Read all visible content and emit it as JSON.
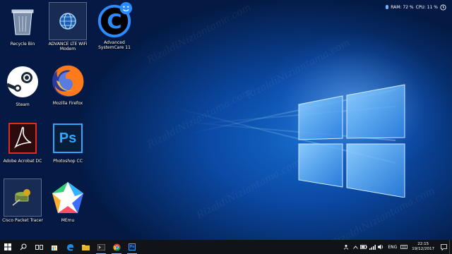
{
  "desktop": {
    "icons": [
      {
        "label": "Recycle Bin",
        "icon": "recycle-bin-icon"
      },
      {
        "label": "ADVANCE LTE WiFi Modem",
        "icon": "modem-globe-icon"
      },
      {
        "label": "Advanced SystemCare 11",
        "icon": "advanced-systemcare-icon"
      },
      {
        "label": "Steam",
        "icon": "steam-icon"
      },
      {
        "label": "Mozilla Firefox",
        "icon": "firefox-icon"
      },
      {
        "label": "Adobe Acrobat DC",
        "icon": "acrobat-icon"
      },
      {
        "label": "Photoshop CC",
        "icon": "photoshop-icon"
      },
      {
        "label": "Cisco Packet Tracer",
        "icon": "packet-tracer-icon"
      },
      {
        "label": "MEmu",
        "icon": "memu-icon"
      }
    ],
    "ps_text": "Ps"
  },
  "widget": {
    "ram": "RAM: 72 %",
    "cpu": "CPU: 11 %"
  },
  "taskbar": {
    "buttons": [
      "start-icon",
      "search-icon",
      "task-view-icon",
      "store-icon",
      "edge-icon",
      "file-explorer-icon",
      "cmd-icon",
      "chrome-icon",
      "photoshop-icon"
    ],
    "tray": {
      "language": "ENG",
      "time": "22:15",
      "date": "19/12/2017"
    }
  },
  "watermark_text": "RizaldiNiziantama.com",
  "colors": {
    "wallpaper_glow": "#5fb4ff",
    "taskbar": "#101418",
    "accent": "#7fb6ff"
  }
}
